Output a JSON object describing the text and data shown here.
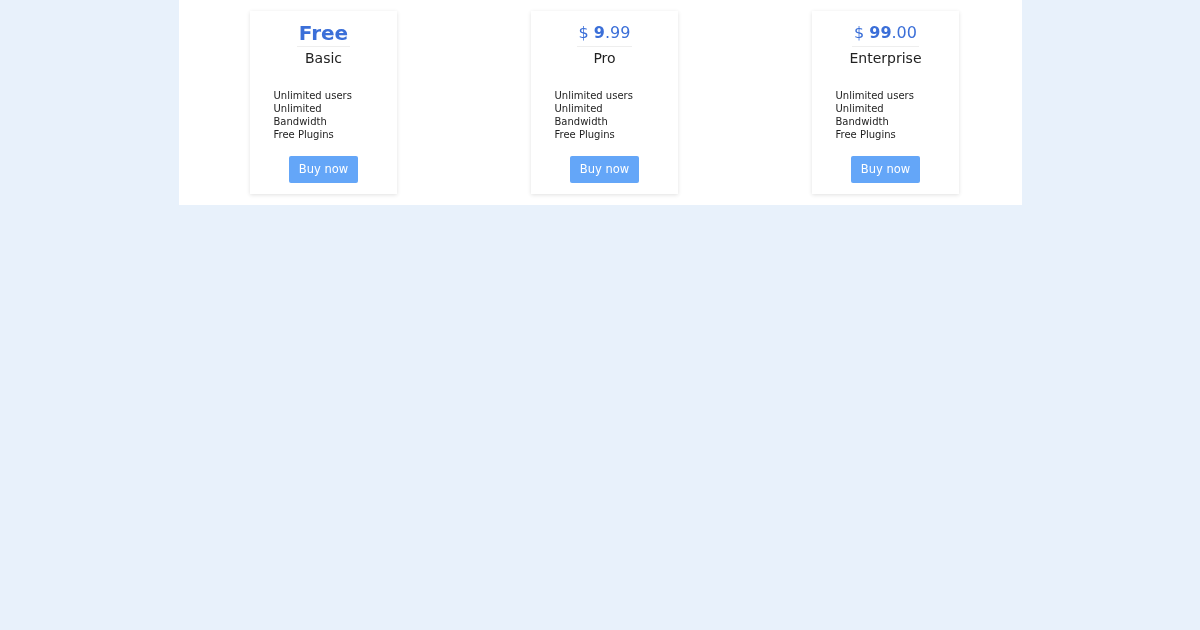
{
  "plans": [
    {
      "kind": "word",
      "price": "Free",
      "name": "Basic",
      "features": [
        "Unlimited users",
        "Unlimited Bandwidth",
        "Free Plugins"
      ],
      "button": "Buy now"
    },
    {
      "kind": "amount",
      "price": "$ **9**.99",
      "name": "Pro",
      "features": [
        "Unlimited users",
        "Unlimited Bandwidth",
        "Free Plugins"
      ],
      "button": "Buy now"
    },
    {
      "kind": "amount",
      "price": "$ **99**.00",
      "name": "Enterprise",
      "features": [
        "Unlimited users",
        "Unlimited Bandwidth",
        "Free Plugins"
      ],
      "button": "Buy now"
    }
  ]
}
